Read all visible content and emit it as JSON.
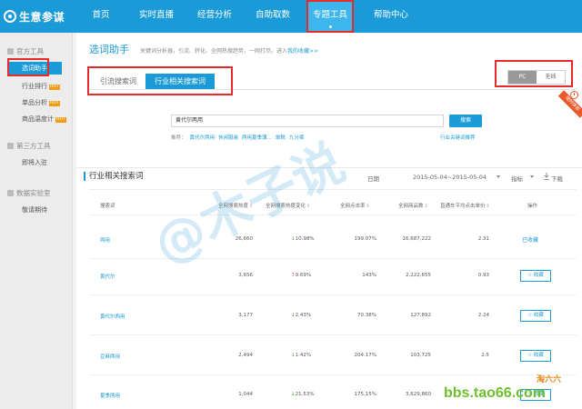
{
  "app": {
    "name": "生意参谋",
    "nav": [
      "首页",
      "实时直播",
      "经营分析",
      "自助取数",
      "专题工具",
      "帮助中心"
    ],
    "active_nav": "专题工具"
  },
  "sidebar": {
    "groups": [
      {
        "title": "官方工具",
        "items": [
          "选词助手",
          "行业排行",
          "单品分析",
          "商品温度计"
        ]
      },
      {
        "title": "第三方工具",
        "items": [
          "即将入驻"
        ]
      },
      {
        "title": "数据实验室",
        "items": [
          "敬请期待"
        ]
      }
    ],
    "active_item": "选词助手",
    "hot_badge": "HOT"
  },
  "page": {
    "title": "选词助手",
    "description": "关键词分析器，引流、转化、全网热搜趋势，一网打尽。进入",
    "favorites_link": "我的收藏>>",
    "tabs": [
      "引流搜索词",
      "行业相关搜索词"
    ],
    "device": {
      "on": "PC",
      "off": "无线"
    },
    "ribbon": "限时体验"
  },
  "search": {
    "value": "黄代尔两用",
    "button": "搜索",
    "rec_label": "推荐：",
    "recommendations": [
      "黄代尔两用",
      "休闲服装",
      "两用夏季薄...",
      "单靴",
      "九分裤"
    ],
    "suggest_link": "行业关键词推荐"
  },
  "section": {
    "title": "行业相关搜索词",
    "date_label": "日期",
    "date_range": "2015-05-04~2015-05-04",
    "metric_label": "指标",
    "download_label": "下载"
  },
  "table": {
    "headers": [
      "搜索词",
      "全网搜索热度",
      "全网搜索热度变化",
      "全网点击率",
      "全网商品数",
      "直通车平均点击单价",
      "操作"
    ],
    "rows": [
      {
        "keyword": "两用",
        "heat": "26,660",
        "change": "10.98%",
        "dir": "up",
        "ctr": "199.07%",
        "items": "16,687,222",
        "cpc": "2.31",
        "action": "已收藏"
      },
      {
        "keyword": "黄代尔",
        "heat": "3,656",
        "change": "9.69%",
        "dir": "down",
        "ctr": "143%",
        "items": "2,222,655",
        "cpc": "0.93",
        "action": "收藏"
      },
      {
        "keyword": "黄代尔两用",
        "heat": "3,177",
        "change": "2.43%",
        "dir": "up",
        "ctr": "70.38%",
        "items": "127,892",
        "cpc": "2.24",
        "action": "收藏"
      },
      {
        "keyword": "豆麻两用",
        "heat": "2,494",
        "change": "1.42%",
        "dir": "up",
        "ctr": "204.17%",
        "items": "103,725",
        "cpc": "2.5",
        "action": "收藏"
      },
      {
        "keyword": "夏季两用",
        "heat": "1,044",
        "change": "21.53%",
        "dir": "up",
        "ctr": "175.15%",
        "items": "3,629,860",
        "cpc": "",
        "action": "收藏"
      }
    ]
  },
  "watermarks": {
    "big": "@木子说",
    "site": "bbs.tao66.com",
    "brand": "淘六六"
  },
  "colors": {
    "primary": "#1a9ad6",
    "highlight": "#e52b2b",
    "ribbon": "#e85a2a",
    "up": "#3a9d3a",
    "down": "#d9534f"
  }
}
